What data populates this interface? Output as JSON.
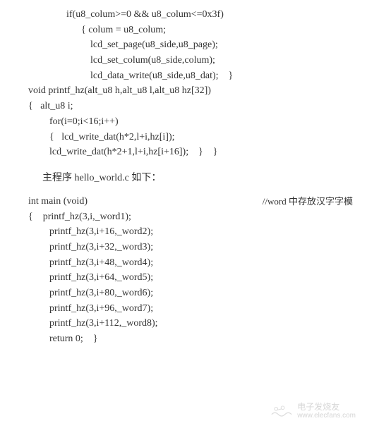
{
  "block1": {
    "l1": "if(u8_colum>=0 && u8_colum<=0x3f)",
    "l2": "{ colum = u8_colum;",
    "l3": "lcd_set_page(u8_side,u8_page);",
    "l4": "lcd_set_colum(u8_side,colum);",
    "l5": "lcd_data_write(u8_side,u8_dat);    }",
    "l6": "void printf_hz(alt_u8 h,alt_u8 l,alt_u8 hz[32])",
    "l7": "{   alt_u8 i;",
    "l8": "for(i=0;i<16;i++)",
    "l9": "{   lcd_write_dat(h*2,l+i,hz[i]);",
    "l10": "lcd_write_dat(h*2+1,l+i,hz[i+16]);    }    }"
  },
  "description": "主程序 hello_world.c 如下：",
  "block2": {
    "l1": "int main (void)",
    "comment": "//word 中存放汉字字模",
    "l2": "{    printf_hz(3,i,_word1);",
    "l3": "printf_hz(3,i+16,_word2);",
    "l4": "printf_hz(3,i+32,_word3);",
    "l5": "printf_hz(3,i+48,_word4);",
    "l6": "printf_hz(3,i+64,_word5);",
    "l7": "printf_hz(3,i+80,_word6);",
    "l8": "printf_hz(3,i+96,_word7);",
    "l9": "printf_hz(3,i+112,_word8);",
    "l10": "return 0;    }"
  },
  "watermark": {
    "cn": "电子发烧友",
    "url": "www.elecfans.com"
  }
}
